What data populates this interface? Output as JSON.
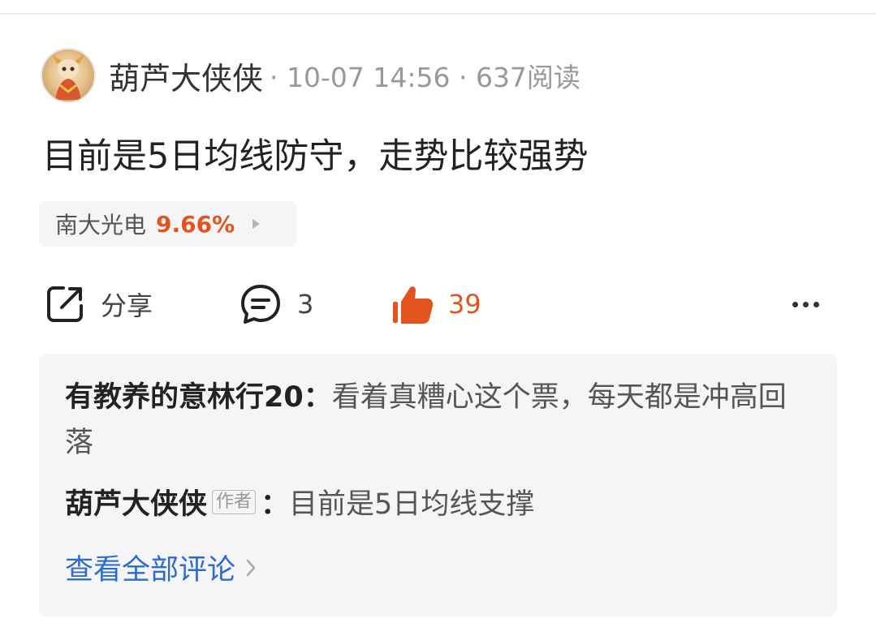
{
  "post": {
    "author": "葫芦大侠侠",
    "meta": "· 10-07 14:56 · 637阅读",
    "text": "目前是5日均线防守，走势比较强势"
  },
  "stock_tag": {
    "name": "南大光电",
    "change": "9.66%"
  },
  "actions": {
    "share_label": "分享",
    "comment_count": "3",
    "like_count": "39"
  },
  "comments": [
    {
      "author": "有教养的意林行20",
      "separator": "：",
      "text": "看着真糟心这个票，每天都是冲高回落"
    },
    {
      "author": "葫芦大侠侠",
      "badge": "作者",
      "separator": "：",
      "text": "目前是5日均线支撑"
    }
  ],
  "view_all_label": "查看全部评论",
  "colors": {
    "accent_orange": "#e2541e",
    "link_blue": "#2c6ccf",
    "panel_gray": "#f5f5f7"
  }
}
